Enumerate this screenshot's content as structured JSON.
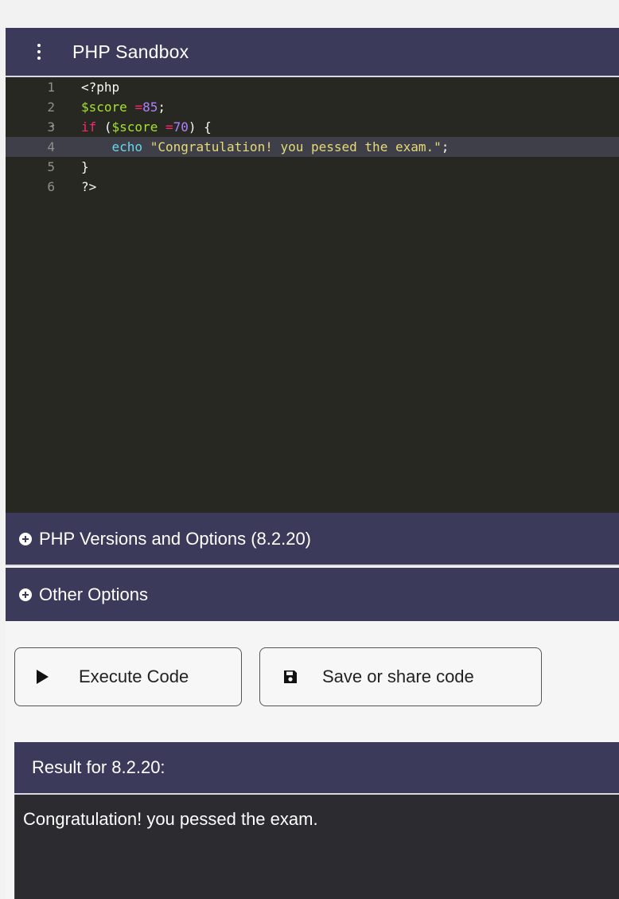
{
  "app": {
    "title": "PHP Sandbox"
  },
  "editor": {
    "active_line": 4,
    "lines": [
      {
        "number": "1",
        "code": "<?php"
      },
      {
        "number": "2",
        "code": "$score =85;"
      },
      {
        "number": "3",
        "code": "if ($score =70) {"
      },
      {
        "number": "4",
        "code": "    echo \"Congratulation! you pessed the exam.\";"
      },
      {
        "number": "5",
        "code": "}"
      },
      {
        "number": "6",
        "code": "?>"
      }
    ]
  },
  "accordions": {
    "versions_label": "PHP Versions and Options (8.2.20)",
    "other_label": "Other Options"
  },
  "buttons": {
    "execute_label": "Execute Code",
    "save_label": "Save or share code"
  },
  "result": {
    "title": "Result for 8.2.20:",
    "output": "Congratulation! you pessed the exam."
  },
  "colors": {
    "header_bg": "#3b3a5a",
    "editor_bg": "#272822",
    "result_bg": "#2c2c30"
  }
}
